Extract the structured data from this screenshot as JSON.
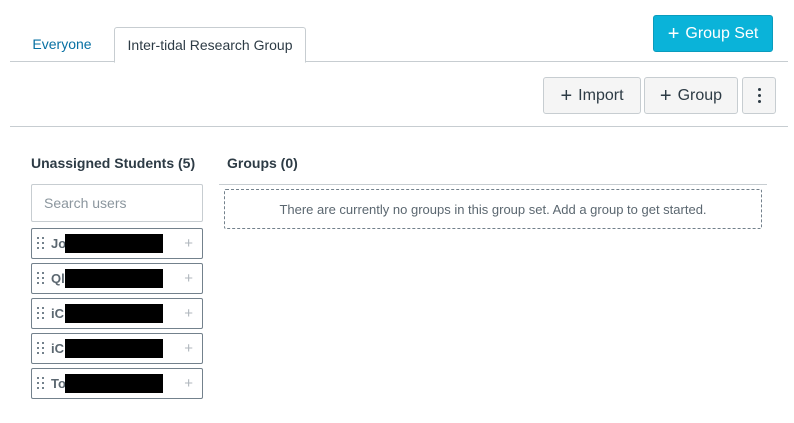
{
  "tabs": [
    {
      "label": "Everyone"
    },
    {
      "label": "Inter-tidal Research Group"
    }
  ],
  "toolbar": {
    "group_set_label": "Group Set",
    "import_label": "Import",
    "group_label": "Group"
  },
  "unassigned": {
    "title": "Unassigned Students (5)",
    "search_placeholder": "Search users",
    "students": [
      {
        "name": "Jo"
      },
      {
        "name": "Ql"
      },
      {
        "name": "iC"
      },
      {
        "name": "iC"
      },
      {
        "name": "To"
      }
    ]
  },
  "groups": {
    "title": "Groups (0)",
    "empty_message": "There are currently no groups in this group set. Add a group to get started."
  },
  "colors": {
    "primary": "#0ab3d9",
    "link": "#0770a3",
    "text": "#2d3b45",
    "border": "#c7cdd1"
  }
}
